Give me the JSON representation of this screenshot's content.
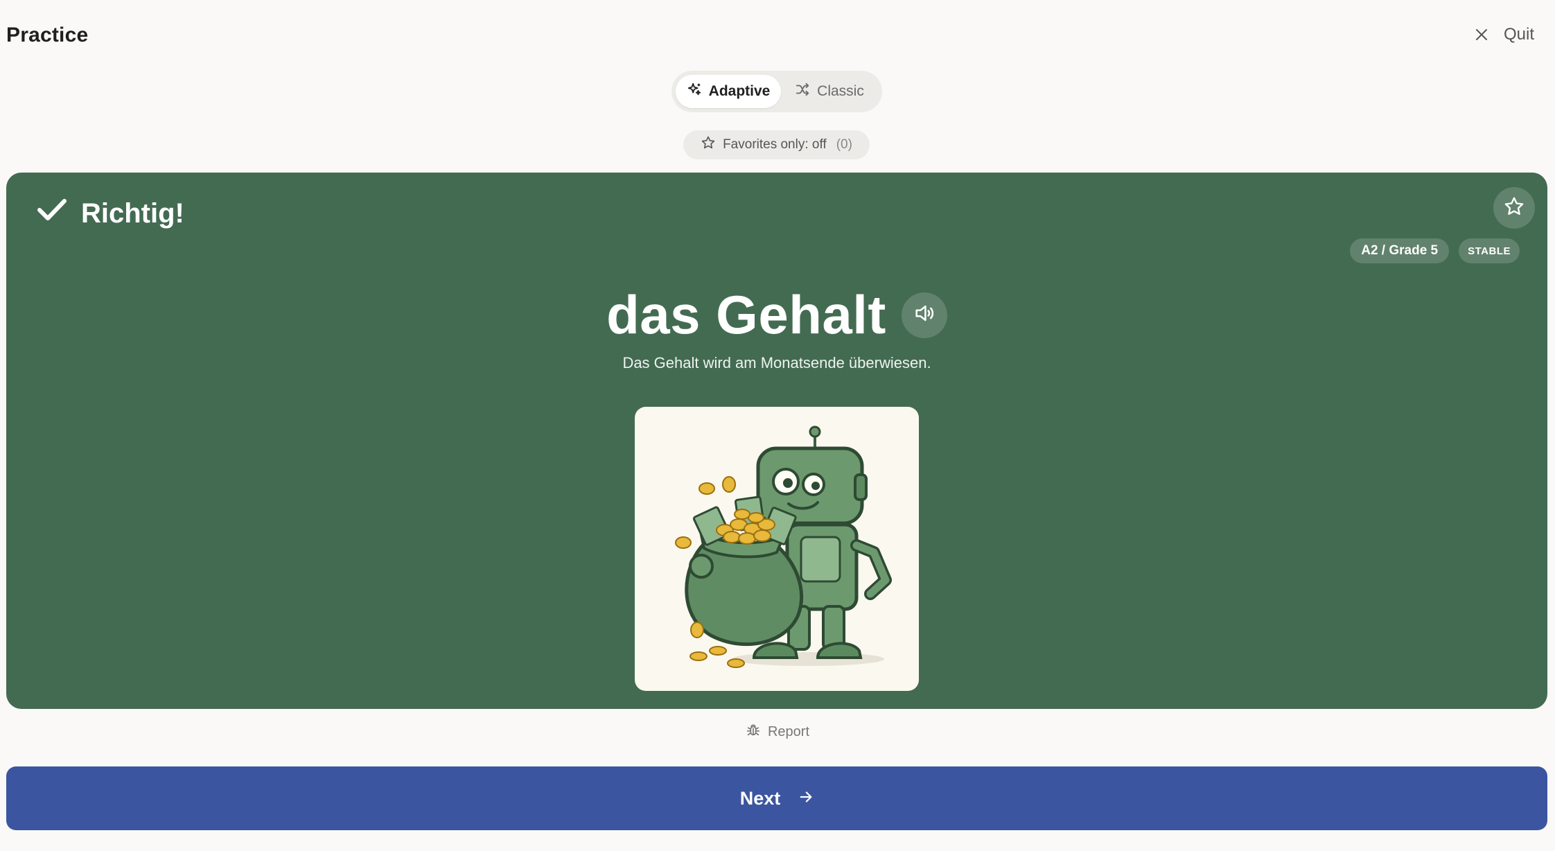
{
  "header": {
    "title": "Practice",
    "quit_label": "Quit"
  },
  "mode_toggle": {
    "options": [
      {
        "label": "Adaptive",
        "icon": "sparkles-icon",
        "active": true
      },
      {
        "label": "Classic",
        "icon": "shuffle-icon",
        "active": false
      }
    ]
  },
  "favorites_filter": {
    "label": "Favorites only: off",
    "count": "(0)",
    "icon": "star-outline-icon"
  },
  "card": {
    "background_color": "#436b52",
    "result_label": "Richtig!",
    "result_icon": "checkmark-icon",
    "favorite_icon": "star-outline-icon",
    "level_badge": "A2 / Grade 5",
    "status_badge": "STABLE",
    "word": "das Gehalt",
    "audio_icon": "speaker-icon",
    "example_sentence": "Das Gehalt wird am Monatsende überwiesen.",
    "image_description_icon": "robot-with-money-bag-illustration"
  },
  "report": {
    "label": "Report",
    "icon": "bug-icon"
  },
  "next_button": {
    "label": "Next",
    "icon": "arrow-right-icon",
    "color": "#3b55a0"
  }
}
